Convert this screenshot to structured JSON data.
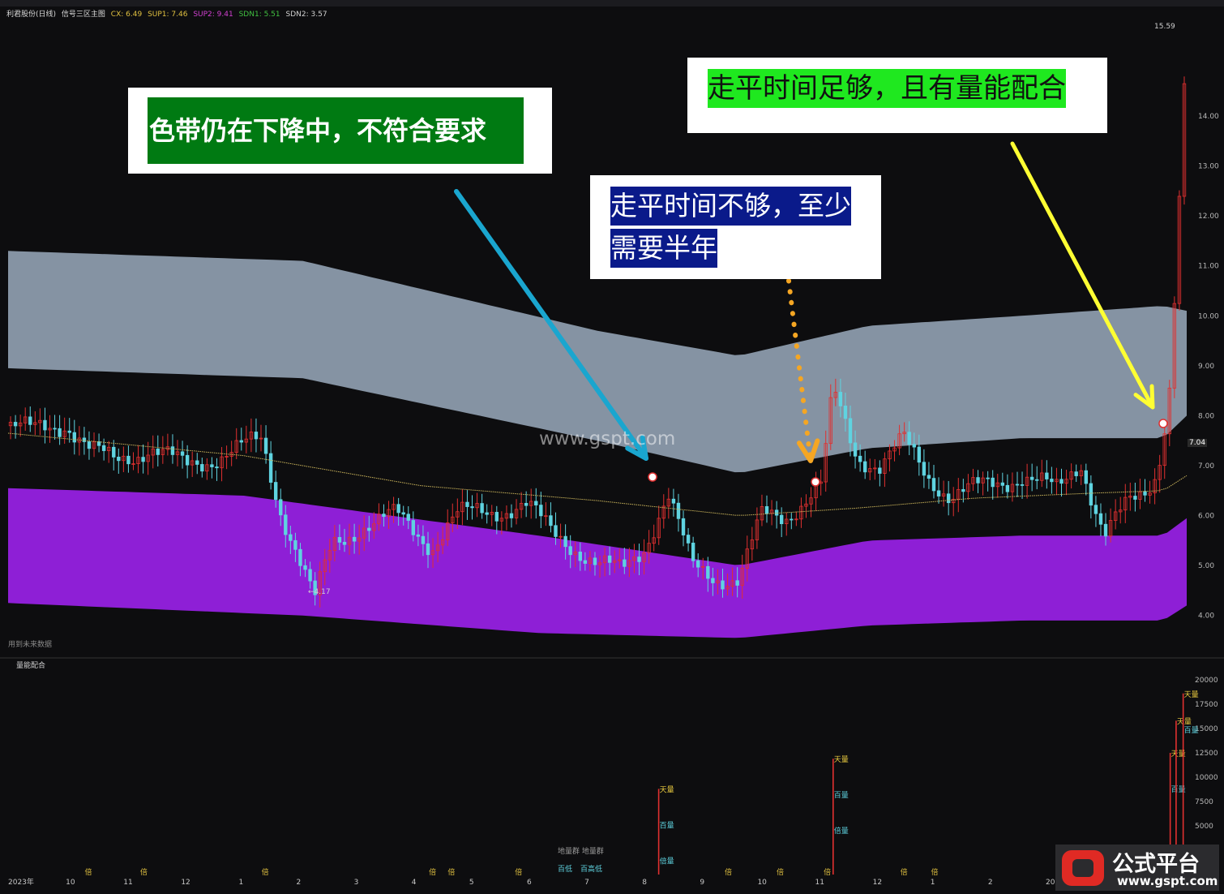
{
  "header": {
    "title": "利君股份(日线)",
    "indicator": "信号三区主图",
    "cx": "CX: 6.49",
    "sup1": "SUP1: 7.46",
    "sup2": "SUP2: 9.41",
    "sdn1": "SDN1: 5.51",
    "sdn2": "SDN2: 3.57"
  },
  "callouts": {
    "green": "色带仍在下降中，不符合要求",
    "blue_line1": "走平时间不够，至少",
    "blue_line2": "需要半年",
    "lime": "走平时间足够，且有量能配合"
  },
  "watermark": "www.gspt.com",
  "labels": {
    "future_data": "用到未来数据",
    "low_marker": "←4.17",
    "high_marker": "15.59",
    "last_price": "7.04",
    "sub_title": "量能配合",
    "sub_legend1": "地量群  地量群",
    "sub_legend2": "百低",
    "sub_legend3": "百高低",
    "tag_tian": "天量",
    "tag_bai": "百量",
    "tag_bei": "倍",
    "tag_beiliang": "倍量"
  },
  "logo": {
    "name": "公式平台",
    "url": "www.gspt.com"
  },
  "colors": {
    "background": "#0d0d0f",
    "upper_band": "#8593a3",
    "lower_band": "#8e1fd6",
    "up_candle": "#e03030",
    "down_candle": "#5fd3e0",
    "ma_line": "#c8b25a",
    "arrow_cyan": "#1aa6cf",
    "arrow_orange": "#f5a623",
    "arrow_yellow": "#ffff33",
    "callout_green_bg": "#007a12",
    "callout_blue_bg": "#0a1a8a",
    "callout_lime_bg": "#1fe81f"
  },
  "chart_data": {
    "type": "candlestick",
    "x_tick_labels": [
      "2023年",
      "10",
      "11",
      "12",
      "1",
      "2",
      "3",
      "4",
      "5",
      "6",
      "7",
      "8",
      "9",
      "10",
      "11",
      "12",
      "1",
      "2",
      "2025/0"
    ],
    "y_tick_labels": [
      "4.00",
      "5.00",
      "6.00",
      "7.00",
      "8.00",
      "9.00",
      "10.00",
      "11.00",
      "12.00",
      "13.00",
      "14.00"
    ],
    "ylim": [
      3.2,
      15.9
    ],
    "close_path": [
      [
        0,
        7.8
      ],
      [
        0.02,
        7.7
      ],
      [
        0.05,
        7.85
      ],
      [
        0.07,
        7.3
      ],
      [
        0.09,
        7.1
      ],
      [
        0.12,
        7.35
      ],
      [
        0.15,
        7.0
      ],
      [
        0.18,
        7.2
      ],
      [
        0.215,
        7.5
      ],
      [
        0.23,
        6.2
      ],
      [
        0.245,
        5.3
      ],
      [
        0.26,
        4.3
      ],
      [
        0.275,
        5.4
      ],
      [
        0.3,
        5.8
      ],
      [
        0.33,
        6.0
      ],
      [
        0.36,
        5.4
      ],
      [
        0.38,
        6.0
      ],
      [
        0.41,
        6.1
      ],
      [
        0.44,
        6.2
      ],
      [
        0.46,
        5.7
      ],
      [
        0.48,
        5.4
      ],
      [
        0.5,
        5.0
      ],
      [
        0.52,
        4.9
      ],
      [
        0.54,
        5.4
      ],
      [
        0.56,
        6.4
      ],
      [
        0.58,
        5.0
      ],
      [
        0.6,
        4.8
      ],
      [
        0.62,
        4.7
      ],
      [
        0.64,
        6.0
      ],
      [
        0.66,
        6.0
      ],
      [
        0.69,
        6.6
      ],
      [
        0.7,
        8.5
      ],
      [
        0.72,
        7.2
      ],
      [
        0.74,
        7.0
      ],
      [
        0.76,
        7.5
      ],
      [
        0.78,
        6.8
      ],
      [
        0.8,
        6.4
      ],
      [
        0.83,
        6.6
      ],
      [
        0.86,
        6.8
      ],
      [
        0.89,
        6.5
      ],
      [
        0.91,
        7.1
      ],
      [
        0.93,
        5.6
      ],
      [
        0.95,
        6.2
      ],
      [
        0.965,
        6.5
      ],
      [
        0.975,
        6.9
      ],
      [
        0.985,
        8.4
      ],
      [
        0.99,
        10.5
      ],
      [
        0.995,
        13.0
      ],
      [
        1.0,
        15.5
      ]
    ],
    "bands": {
      "upper_top": [
        [
          0,
          11.3
        ],
        [
          0.25,
          11.1
        ],
        [
          0.5,
          9.7
        ],
        [
          0.62,
          9.2
        ],
        [
          0.73,
          9.8
        ],
        [
          0.86,
          10.0
        ],
        [
          0.98,
          10.2
        ],
        [
          1.0,
          10.1
        ]
      ],
      "upper_bottom": [
        [
          0,
          8.95
        ],
        [
          0.25,
          8.75
        ],
        [
          0.5,
          7.5
        ],
        [
          0.62,
          6.85
        ],
        [
          0.73,
          7.35
        ],
        [
          0.86,
          7.55
        ],
        [
          0.98,
          7.55
        ],
        [
          1.0,
          8.0
        ]
      ],
      "lower_top": [
        [
          0,
          6.55
        ],
        [
          0.2,
          6.4
        ],
        [
          0.45,
          5.6
        ],
        [
          0.62,
          5.0
        ],
        [
          0.73,
          5.5
        ],
        [
          0.86,
          5.6
        ],
        [
          0.98,
          5.6
        ],
        [
          1.0,
          5.95
        ]
      ],
      "lower_bottom": [
        [
          0,
          4.25
        ],
        [
          0.25,
          4.0
        ],
        [
          0.45,
          3.65
        ],
        [
          0.62,
          3.55
        ],
        [
          0.73,
          3.8
        ],
        [
          0.86,
          3.9
        ],
        [
          0.98,
          3.9
        ],
        [
          1.0,
          4.2
        ]
      ]
    },
    "ma_path": [
      [
        0,
        7.65
      ],
      [
        0.2,
        7.2
      ],
      [
        0.35,
        6.6
      ],
      [
        0.5,
        6.3
      ],
      [
        0.62,
        6.0
      ],
      [
        0.72,
        6.15
      ],
      [
        0.82,
        6.35
      ],
      [
        0.92,
        6.45
      ],
      [
        0.98,
        6.5
      ],
      [
        1.0,
        6.8
      ]
    ],
    "subchart": {
      "title": "量能配合",
      "y_tick_labels": [
        "5000",
        "7500",
        "10000",
        "12500",
        "15000",
        "17500",
        "20000"
      ],
      "ylim": [
        0,
        21000
      ],
      "spikes": [
        {
          "x": 0.552,
          "value": 8800,
          "tags": [
            "天量",
            "百量",
            "倍量"
          ]
        },
        {
          "x": 0.7,
          "value": 11900,
          "tags": [
            "天量",
            "百量",
            "倍量"
          ]
        },
        {
          "x": 0.986,
          "value": 12500,
          "tags": [
            "天量",
            "百量"
          ]
        },
        {
          "x": 0.991,
          "value": 15800,
          "tags": [
            "天量"
          ]
        },
        {
          "x": 0.997,
          "value": 18600,
          "tags": [
            "天量",
            "百量"
          ]
        }
      ]
    }
  }
}
